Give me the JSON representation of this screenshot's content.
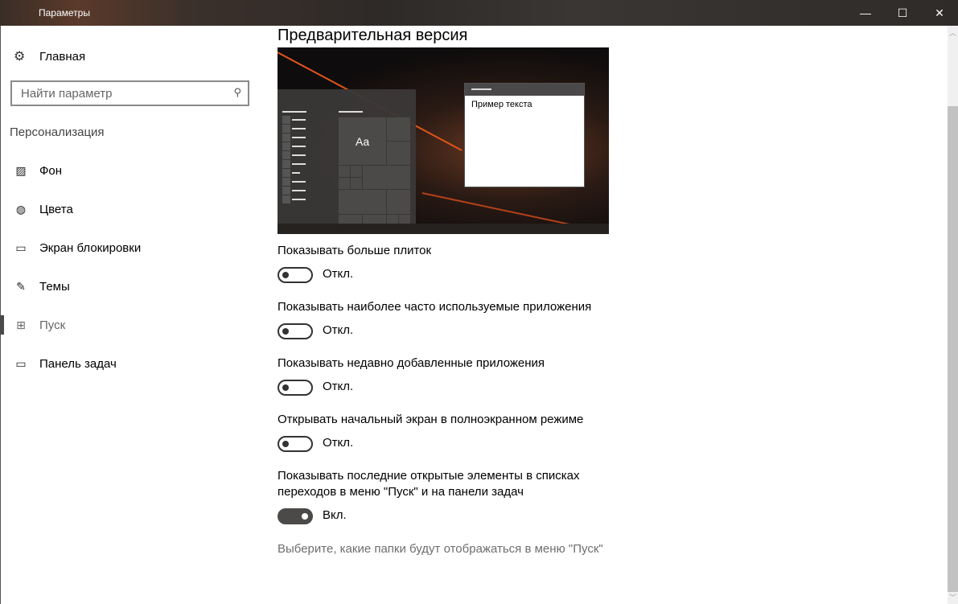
{
  "window": {
    "title": "Параметры",
    "minimize": "—",
    "maximize": "☐",
    "close": "✕"
  },
  "sidebar": {
    "home": "Главная",
    "search_placeholder": "Найти параметр",
    "section": "Персонализация",
    "items": [
      {
        "label": "Фон",
        "icon": "picture-icon"
      },
      {
        "label": "Цвета",
        "icon": "palette-icon"
      },
      {
        "label": "Экран блокировки",
        "icon": "lock-screen-icon"
      },
      {
        "label": "Темы",
        "icon": "themes-icon"
      },
      {
        "label": "Пуск",
        "icon": "start-icon",
        "selected": true
      },
      {
        "label": "Панель задач",
        "icon": "taskbar-icon"
      }
    ]
  },
  "main": {
    "heading": "Предварительная версия",
    "preview_tile": "Aa",
    "preview_sample": "Пример текста",
    "settings": [
      {
        "label": "Показывать больше плиток",
        "state": "Откл.",
        "on": false
      },
      {
        "label": "Показывать наиболее часто используемые приложения",
        "state": "Откл.",
        "on": false
      },
      {
        "label": "Показывать недавно добавленные приложения",
        "state": "Откл.",
        "on": false
      },
      {
        "label": "Открывать начальный экран в полноэкранном режиме",
        "state": "Откл.",
        "on": false
      },
      {
        "label": "Показывать последние открытые элементы в списках переходов в меню \"Пуск\" и на панели задач",
        "state": "Вкл.",
        "on": true
      }
    ],
    "link": "Выберите, какие папки будут отображаться в меню \"Пуск\""
  }
}
